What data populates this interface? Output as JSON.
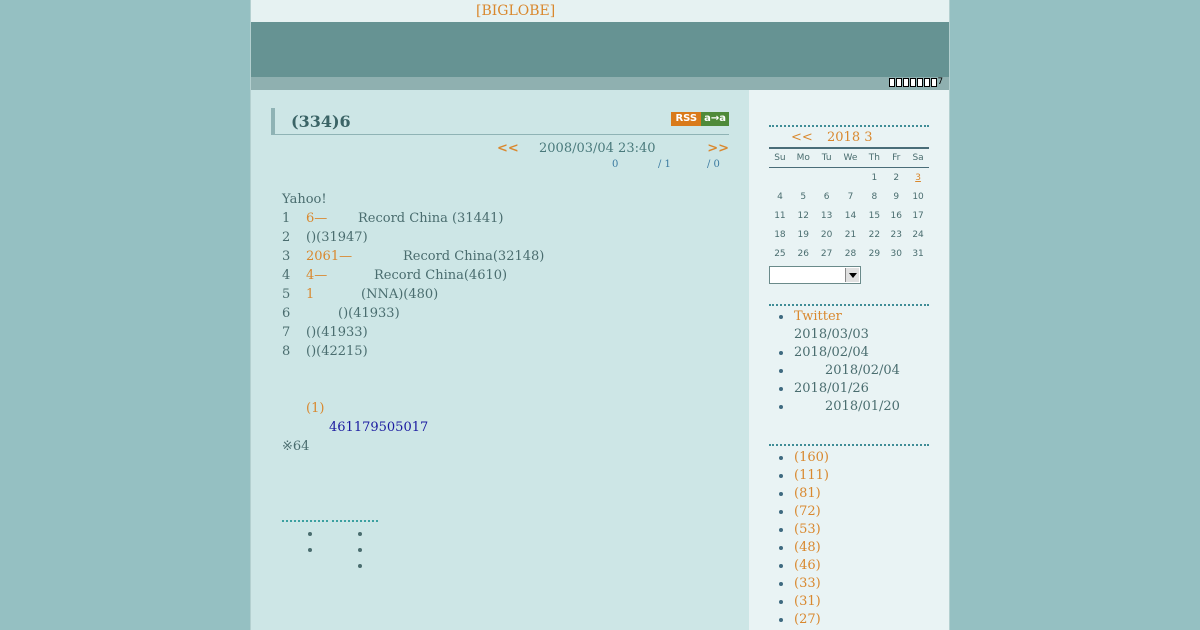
{
  "header": {
    "brand_link": "[BIGLOBE]",
    "counter": "0000002",
    "counter_tail": "7"
  },
  "entry": {
    "title": "(334)6",
    "rss_label": "RSS",
    "aa_label": "a→a",
    "prev_label": "<<",
    "date": "2008/03/04 23:40",
    "next_label": ">>",
    "stats": [
      "0",
      "/ 1",
      "/ 0"
    ],
    "intro": "Yahoo!",
    "items": [
      {
        "num": "1",
        "highlight": "6—",
        "text": "Record China (31441)"
      },
      {
        "num": "2",
        "highlight": "",
        "text": "()(31947)"
      },
      {
        "num": "3",
        "highlight": "2061—",
        "text": "Record China(32148)"
      },
      {
        "num": "4",
        "highlight": "4—",
        "text": "Record China(4610)"
      },
      {
        "num": "5",
        "highlight": "1",
        "text": "(NNA)(480)"
      },
      {
        "num": "6",
        "highlight": "",
        "text": "()(41933)"
      },
      {
        "num": "7",
        "highlight": "",
        "text": "()(41933)"
      },
      {
        "num": "8",
        "highlight": "",
        "text": "()(42215)"
      }
    ],
    "comment_link": "(1)",
    "phone_number": "461179505017",
    "note": "※64"
  },
  "calendar": {
    "prev_label": "<<",
    "title": "2018 3",
    "weekdays": [
      "Su",
      "Mo",
      "Tu",
      "We",
      "Th",
      "Fr",
      "Sa"
    ],
    "weeks": [
      [
        "",
        "",
        "",
        "",
        "1",
        "2",
        "3"
      ],
      [
        "4",
        "5",
        "6",
        "7",
        "8",
        "9",
        "10"
      ],
      [
        "11",
        "12",
        "13",
        "14",
        "15",
        "16",
        "17"
      ],
      [
        "18",
        "19",
        "20",
        "21",
        "22",
        "23",
        "24"
      ],
      [
        "25",
        "26",
        "27",
        "28",
        "29",
        "30",
        "31"
      ]
    ],
    "linked_day": "3"
  },
  "recent": [
    {
      "label": "Twitter",
      "date": "2018/03/03"
    },
    {
      "label": "2018/02/04",
      "date": ""
    },
    {
      "label": "2018/02/04",
      "date": ""
    },
    {
      "label": "2018/01/26",
      "date": ""
    },
    {
      "label": "2018/01/20",
      "date": ""
    }
  ],
  "categories": [
    "(160)",
    "(111)",
    "(81)",
    "(72)",
    "(53)",
    "(48)",
    "(46)",
    "(33)",
    "(31)",
    "(27)"
  ],
  "colors": {
    "accent": "#d9882e",
    "text": "#4a6d6f",
    "banner": "#669393",
    "page_bg": "#95c0c2"
  }
}
